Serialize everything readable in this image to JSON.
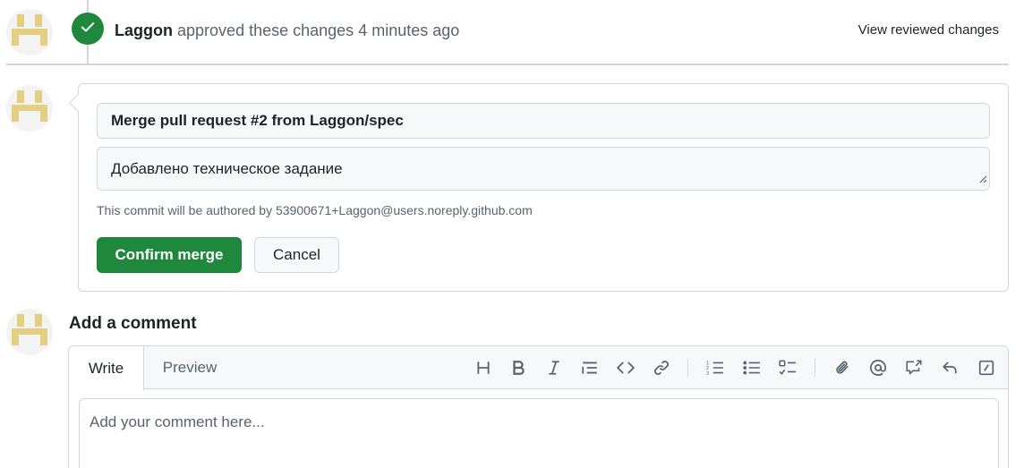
{
  "review": {
    "author": "Laggon",
    "action_text": "approved these changes",
    "time_ago": "4 minutes ago",
    "view_link": "View reviewed changes"
  },
  "merge": {
    "commit_title": "Merge pull request #2 from Laggon/spec",
    "commit_body": "Добавлено техническое задание",
    "author_note": "This commit will be authored by 53900671+Laggon@users.noreply.github.com",
    "confirm_label": "Confirm merge",
    "cancel_label": "Cancel"
  },
  "comment": {
    "heading": "Add a comment",
    "tabs": {
      "write": "Write",
      "preview": "Preview"
    },
    "placeholder": "Add your comment here...",
    "toolbar_icons": [
      "heading-icon",
      "bold-icon",
      "italic-icon",
      "quote-icon",
      "code-icon",
      "link-icon",
      "ordered-list-icon",
      "unordered-list-icon",
      "task-list-icon",
      "attach-icon",
      "mention-icon",
      "cross-reference-icon",
      "saved-reply-icon",
      "slash-command-icon"
    ]
  },
  "colors": {
    "accent_green": "#1f883d",
    "border": "#d0d7de",
    "muted_text": "#59636e",
    "avatar_pattern": "#e3cf7f"
  }
}
